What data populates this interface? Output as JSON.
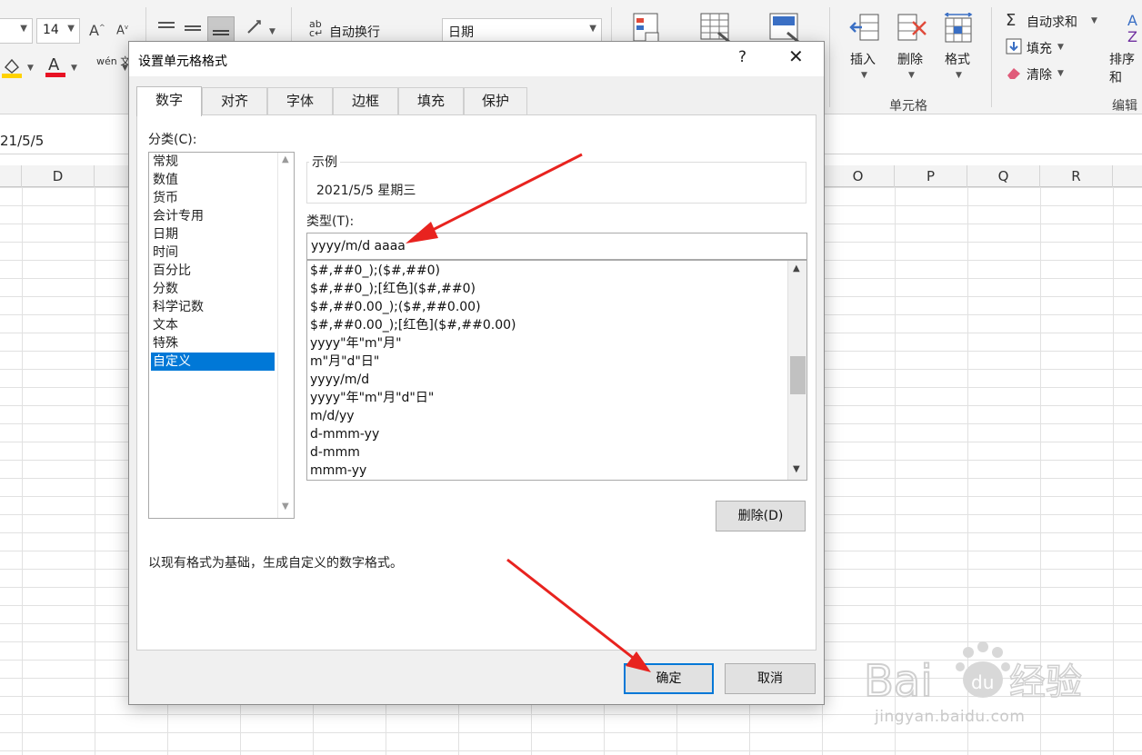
{
  "ribbon": {
    "font_size": "14",
    "wrap_text_label": "自动换行",
    "number_format": "日期",
    "phonetic_label": "wén 文",
    "insert_label": "插入",
    "delete_label": "删除",
    "format_label": "格式",
    "cells_group": "单元格",
    "autosum_label": "自动求和",
    "fill_label": "填充",
    "clear_label": "清除",
    "sort_label": "排序和",
    "edit_group": "编辑"
  },
  "formula_bar": {
    "value": "21/5/5"
  },
  "columns": [
    {
      "label": "D",
      "width": 80
    },
    {
      "label": "O",
      "width": 80
    },
    {
      "label": "P",
      "width": 80
    },
    {
      "label": "Q",
      "width": 80
    },
    {
      "label": "R",
      "width": 80
    }
  ],
  "dialog": {
    "title": "设置单元格格式",
    "help": "?",
    "close": "✕",
    "tabs": [
      "数字",
      "对齐",
      "字体",
      "边框",
      "填充",
      "保护"
    ],
    "active_tab": "数字",
    "category_label": "分类(C):",
    "categories": [
      "常规",
      "数值",
      "货币",
      "会计专用",
      "日期",
      "时间",
      "百分比",
      "分数",
      "科学记数",
      "文本",
      "特殊",
      "自定义"
    ],
    "selected_category": "自定义",
    "sample_label": "示例",
    "sample_value": "2021/5/5 星期三",
    "type_label": "类型(T):",
    "type_value": "yyyy/m/d aaaa",
    "formats": [
      "$#,##0_);($#,##0)",
      "$#,##0_);[红色]($#,##0)",
      "$#,##0.00_);($#,##0.00)",
      "$#,##0.00_);[红色]($#,##0.00)",
      "yyyy\"年\"m\"月\"",
      "m\"月\"d\"日\"",
      "yyyy/m/d",
      "yyyy\"年\"m\"月\"d\"日\"",
      "m/d/yy",
      "d-mmm-yy",
      "d-mmm",
      "mmm-yy"
    ],
    "delete_button": "删除(D)",
    "description": "以现有格式为基础，生成自定义的数字格式。",
    "ok_button": "确定",
    "cancel_button": "取消"
  },
  "watermark": {
    "text": "jingyan.baidu.com"
  },
  "colors": {
    "selection": "#0078d7",
    "annotation": "#e8231f"
  }
}
